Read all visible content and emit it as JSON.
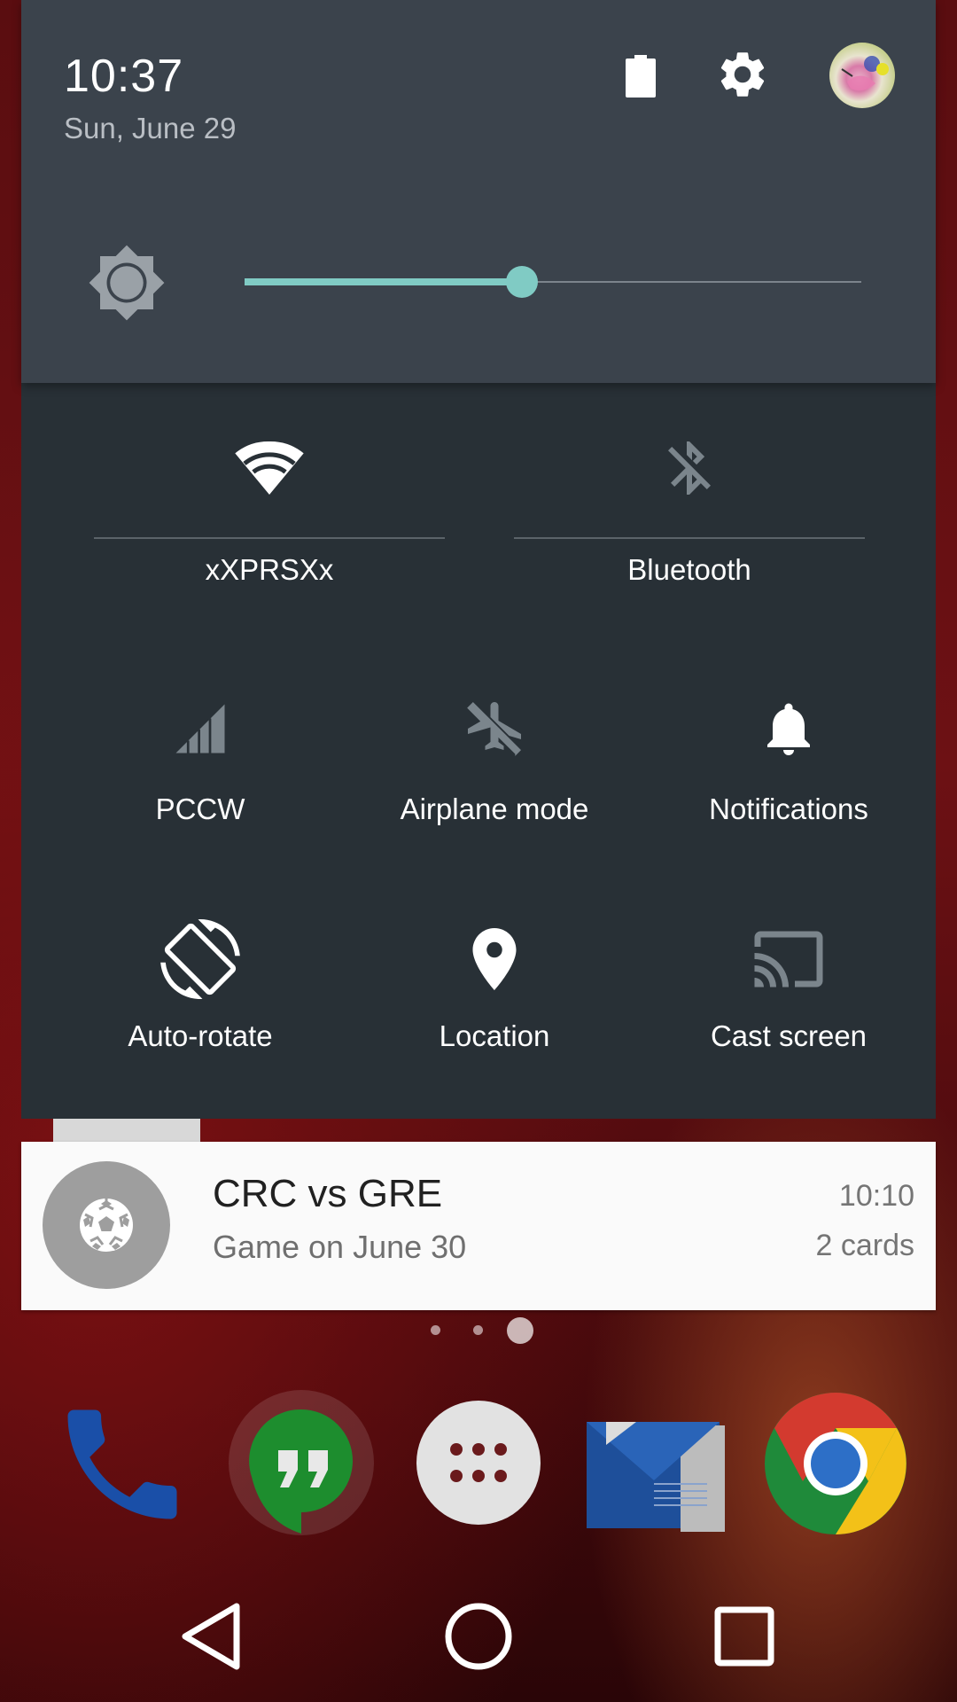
{
  "status_header": {
    "time": "10:37",
    "date": "Sun, June 29"
  },
  "brightness": {
    "level": 0.45
  },
  "tiles": {
    "wifi": {
      "label": "xXPRSXx",
      "icon": "wifi-icon",
      "active": true
    },
    "bluetooth": {
      "label": "Bluetooth",
      "icon": "bluetooth-off-icon",
      "active": false
    },
    "mobile": {
      "label": "PCCW",
      "icon": "signal-icon",
      "active": false
    },
    "airplane": {
      "label": "Airplane mode",
      "icon": "airplane-off-icon",
      "active": false
    },
    "notifications": {
      "label": "Notifications",
      "icon": "bell-icon",
      "active": true
    },
    "rotate": {
      "label": "Auto-rotate",
      "icon": "screen-rotation-icon",
      "active": true
    },
    "location": {
      "label": "Location",
      "icon": "location-pin-icon",
      "active": true
    },
    "cast": {
      "label": "Cast screen",
      "icon": "cast-icon",
      "active": false
    }
  },
  "notification": {
    "title": "CRC vs GRE",
    "text": "Game on June 30",
    "time": "10:10",
    "count": "2 cards",
    "icon": "soccer-ball-icon"
  },
  "dock": [
    "phone-icon",
    "hangouts-icon",
    "app-drawer-icon",
    "newsstand-icon",
    "chrome-icon"
  ],
  "nav": [
    "back-icon",
    "home-icon",
    "recents-icon"
  ],
  "colors": {
    "accent": "#80cbc4",
    "panel_header": "#3b434c",
    "panel_body": "#283036",
    "inactive_icon": "#7b858c"
  }
}
